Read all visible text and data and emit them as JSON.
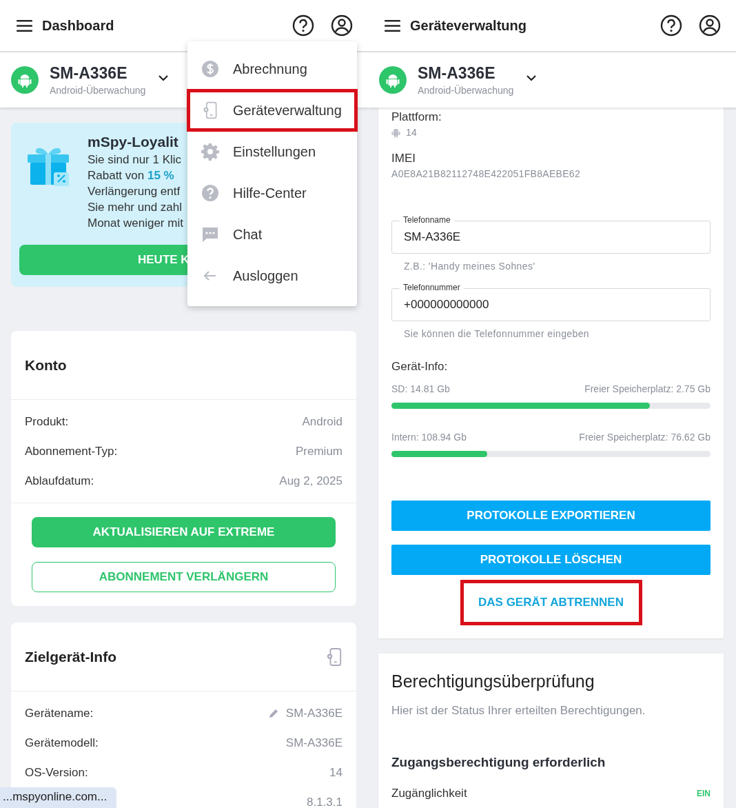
{
  "left_screen": {
    "header": {
      "title": "Dashboard"
    },
    "device": {
      "name": "SM-A336E",
      "subtitle": "Android-Überwachung"
    },
    "promo": {
      "title": "mSpy-Loyalit",
      "lines": [
        "Sie sind nur 1 Klic",
        "Rabatt von **15 %**",
        "Verlängerung entf",
        "Sie mehr und zahl",
        "Monat weniger mit"
      ],
      "button": "HEUTE K"
    },
    "account": {
      "title": "Konto",
      "rows": [
        {
          "label": "Produkt:",
          "value": "Android"
        },
        {
          "label": "Abonnement-Typ:",
          "value": "Premium"
        },
        {
          "label": "Ablaufdatum:",
          "value": "Aug 2, 2025"
        }
      ],
      "buttons": [
        {
          "label": "AKTUALISIEREN AUF EXTREME",
          "kind": "filled"
        },
        {
          "label": "ABONNEMENT VERLÄNGERN",
          "kind": "outline"
        }
      ]
    },
    "target": {
      "title": "Zielgerät-Info",
      "rows": [
        {
          "label": "Gerätename:",
          "value": "SM-A336E",
          "editable": true
        },
        {
          "label": "Gerätemodell:",
          "value": "SM-A336E",
          "editable": false
        },
        {
          "label": "OS-Version:",
          "value": "14",
          "editable": false
        },
        {
          "value": "8.1.3.1",
          "editable": false
        }
      ]
    },
    "menu": {
      "items": [
        {
          "label": "Abrechnung",
          "kind": "billing",
          "highlighted": false
        },
        {
          "label": "Geräteverwaltung",
          "kind": "devices",
          "highlighted": true
        },
        {
          "label": "Einstellungen",
          "kind": "settings",
          "highlighted": false
        },
        {
          "label": "Hilfe-Center",
          "kind": "help",
          "highlighted": false
        },
        {
          "label": "Chat",
          "kind": "chat",
          "highlighted": false
        },
        {
          "label": "Ausloggen",
          "kind": "logout",
          "highlighted": false
        }
      ]
    },
    "url_tooltip": "...mspyonline.com..."
  },
  "right_screen": {
    "header": {
      "title": "Geräteverwaltung"
    },
    "device": {
      "name": "SM-A336E",
      "subtitle": "Android-Überwachung"
    },
    "details": [
      {
        "label": "Plattform:",
        "value": "14",
        "kind": "platform"
      },
      {
        "label": "IMEI",
        "value": "A0E8A21B82112748E422051FB8AEBE62",
        "kind": "plain"
      }
    ],
    "fields": [
      {
        "label": "Telefonname",
        "value": "SM-A336E",
        "hint": "Z.B.: 'Handy meines Sohnes'"
      },
      {
        "label": "Telefonnummer",
        "value": "+000000000000",
        "hint": "Sie können die Telefonnummer eingeben"
      }
    ],
    "storage": {
      "title": "Gerät-Info:",
      "bars": [
        {
          "left": "SD: 14.81 Gb",
          "right": "Freier Speicherplatz: 2.75 Gb",
          "level": 0.81
        },
        {
          "left": "Intern: 108.94 Gb",
          "right": "Freier Speicherplatz: 76.62 Gb",
          "level": 0.3
        }
      ]
    },
    "buttons": [
      {
        "label": "PROTOKOLLE EXPORTIEREN",
        "kind": "filled",
        "highlighted": false
      },
      {
        "label": "PROTOKOLLE LÖSCHEN",
        "kind": "filled",
        "highlighted": false
      },
      {
        "label": "DAS GERÄT ABTRENNEN",
        "kind": "text",
        "highlighted": true
      }
    ],
    "permissions": {
      "title": "Berechtigungsüberprüfung",
      "description": "Hier ist der Status Ihrer erteilten Berechtigungen.",
      "section_title": "Zugangsberechtigung erforderlich",
      "items": [
        {
          "name": "Zugänglichkeit",
          "status": "EIN",
          "on": true
        }
      ]
    }
  }
}
